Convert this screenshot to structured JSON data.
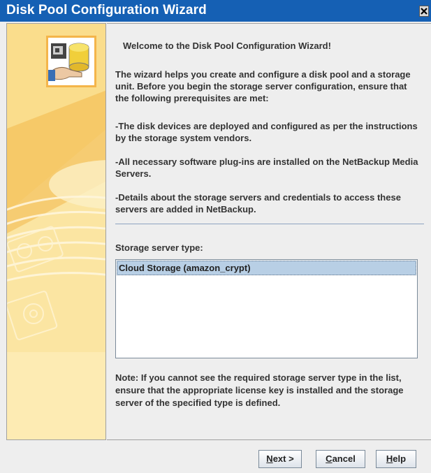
{
  "window": {
    "title": "Disk Pool Configuration Wizard",
    "close_icon": "close-icon"
  },
  "sidebar": {
    "logo_icon": "disk-pool-wizard-icon",
    "accent_color": "#f4b54a"
  },
  "content": {
    "welcome": "Welcome to the Disk Pool Configuration Wizard!",
    "intro": "The wizard helps you create and configure a disk pool and a storage unit. Before you begin the storage server configuration, ensure that the following prerequisites are met:",
    "prereq_1": "-The disk devices are deployed and configured as per the instructions by the storage system vendors.",
    "prereq_2": "-All necessary software plug-ins are installed on the NetBackup Media Servers.",
    "prereq_3": "-Details about the storage servers and credentials to access these servers are added in NetBackup.",
    "storage_server_type_label": "Storage server type:",
    "storage_server_types": [
      "Cloud Storage (amazon_crypt)"
    ],
    "selected_storage_server_type": "Cloud Storage (amazon_crypt)",
    "note": "Note: If you cannot see the required storage server type in the list, ensure that the appropriate license key is installed and the storage server of the specified type is defined."
  },
  "buttons": {
    "next_mnemonic": "N",
    "next_rest": "ext >",
    "cancel_mnemonic": "C",
    "cancel_rest": "ancel",
    "help_mnemonic": "H",
    "help_rest": "elp"
  },
  "colors": {
    "titlebar": "#1560b4",
    "selection": "#b8cfe5",
    "sidebar": "#fbe5a2"
  }
}
